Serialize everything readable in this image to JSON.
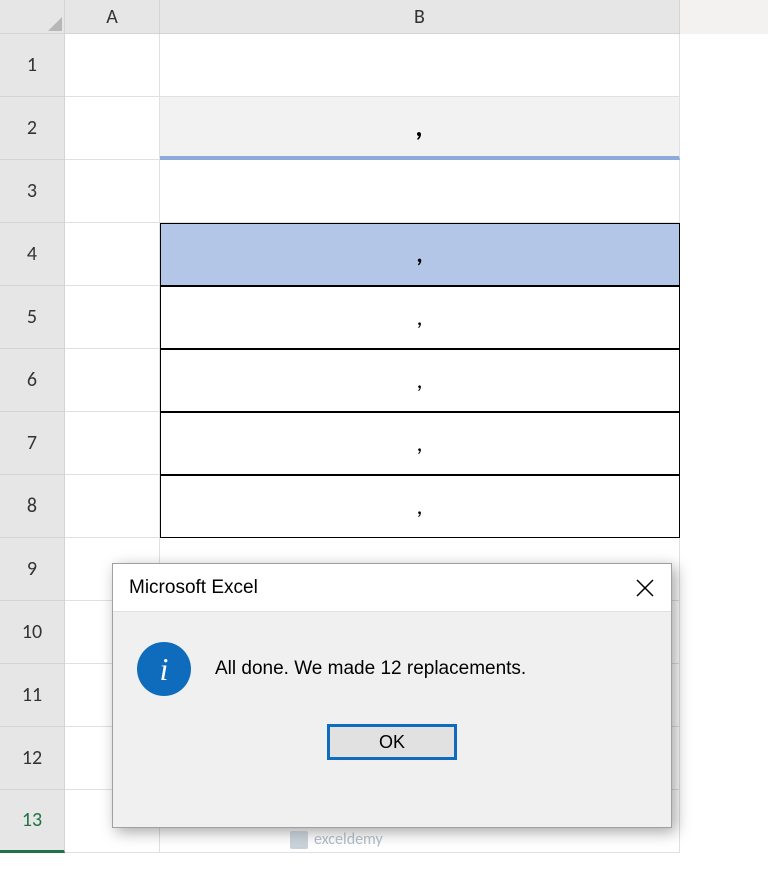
{
  "columns": {
    "A": "A",
    "B": "B"
  },
  "rows": [
    "1",
    "2",
    "3",
    "4",
    "5",
    "6",
    "7",
    "8",
    "9",
    "10",
    "11",
    "12",
    "13"
  ],
  "cells": {
    "B2": ",",
    "B4": ",",
    "B5": ",",
    "B6": ",",
    "B7": ",",
    "B8": ","
  },
  "dialog": {
    "title": "Microsoft Excel",
    "message": "All done. We made 12 replacements.",
    "ok": "OK",
    "info_icon_glyph": "i"
  },
  "watermark": "exceldemy"
}
